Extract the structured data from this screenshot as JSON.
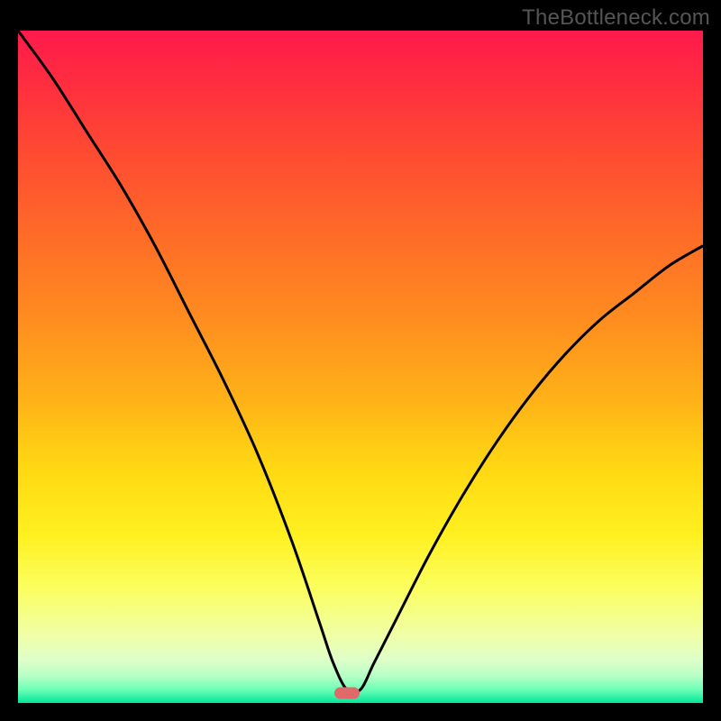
{
  "watermark": "TheBottleneck.com",
  "colors": {
    "background": "#000000",
    "gradient_top": "#ff1a4b",
    "gradient_mid": "#ffe020",
    "gradient_bottom": "#00e69a",
    "curve": "#000000",
    "marker": "#e06a6a"
  },
  "chart_data": {
    "type": "line",
    "title": "",
    "xlabel": "",
    "ylabel": "",
    "xlim": [
      0,
      100
    ],
    "ylim": [
      0,
      100
    ],
    "grid": false,
    "marker": {
      "x": 48,
      "y": 1.5
    },
    "series": [
      {
        "name": "bottleneck_curve",
        "x": [
          0,
          5,
          10,
          15,
          20,
          25,
          30,
          35,
          40,
          44,
          46,
          48,
          50,
          52,
          55,
          60,
          65,
          70,
          75,
          80,
          85,
          90,
          95,
          100
        ],
        "y": [
          100,
          93,
          85,
          77,
          68,
          58,
          48,
          37,
          24,
          12,
          6,
          2,
          2,
          6,
          12,
          22,
          31,
          39,
          46,
          52,
          57,
          61,
          65,
          68
        ]
      }
    ]
  }
}
